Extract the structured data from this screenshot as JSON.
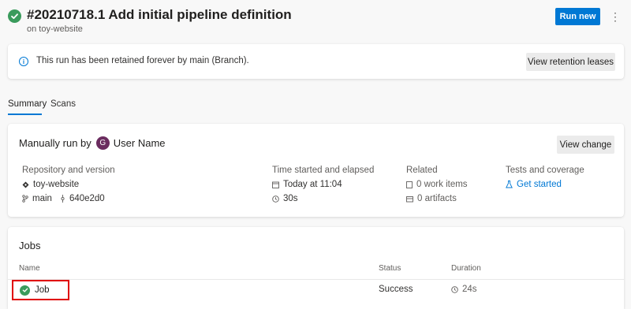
{
  "header": {
    "title": "#20210718.1 Add initial pipeline definition",
    "subtitle": "on toy-website",
    "run_new_label": "Run new",
    "more_label": "⋮"
  },
  "retention": {
    "message": "This run has been retained forever by main (Branch).",
    "button_label": "View retention leases"
  },
  "tabs": [
    {
      "label": "Summary",
      "selected": true
    },
    {
      "label": "Scans",
      "selected": false
    }
  ],
  "summary": {
    "manual_prefix": "Manually run by",
    "avatar_initial": "G",
    "user_name": "User Name",
    "view_change_label": "View change",
    "repo": {
      "label": "Repository and version",
      "name": "toy-website",
      "branch": "main",
      "commit": "640e2d0"
    },
    "time": {
      "label": "Time started and elapsed",
      "started": "Today at 11:04",
      "elapsed": "30s"
    },
    "related": {
      "label": "Related",
      "work_items": "0 work items",
      "artifacts": "0 artifacts"
    },
    "tests": {
      "label": "Tests and coverage",
      "link": "Get started"
    }
  },
  "jobs": {
    "title": "Jobs",
    "columns": {
      "name": "Name",
      "status": "Status",
      "duration": "Duration"
    },
    "rows": [
      {
        "name": "Job",
        "status": "Success",
        "duration": "24s"
      }
    ]
  },
  "colors": {
    "accent": "#0078d4",
    "success": "#2e8b57",
    "avatar": "#6b2c5f",
    "highlight": "#e00000"
  }
}
